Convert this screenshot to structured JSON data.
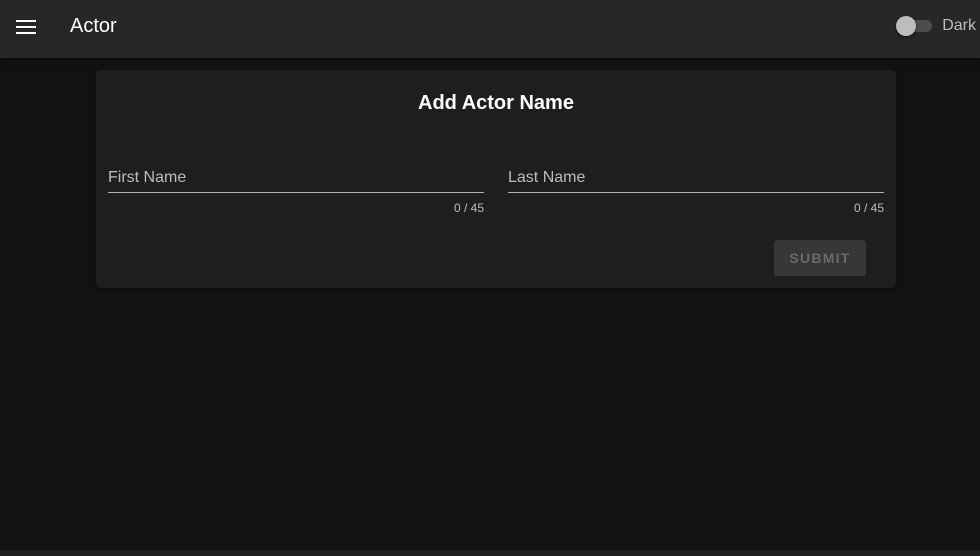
{
  "appbar": {
    "menu_icon": "menu-icon",
    "title": "Actor",
    "theme_toggle": {
      "label": "Dark",
      "enabled": false
    }
  },
  "form": {
    "title": "Add Actor Name",
    "first_name": {
      "label": "First Name",
      "value": "",
      "counter": "0 / 45"
    },
    "last_name": {
      "label": "Last Name",
      "value": "",
      "counter": "0 / 45"
    },
    "submit_label": "SUBMIT"
  },
  "colors": {
    "background": "#121212",
    "appbar": "#272727",
    "card": "#1e1e1e",
    "button_disabled": "#373737"
  }
}
